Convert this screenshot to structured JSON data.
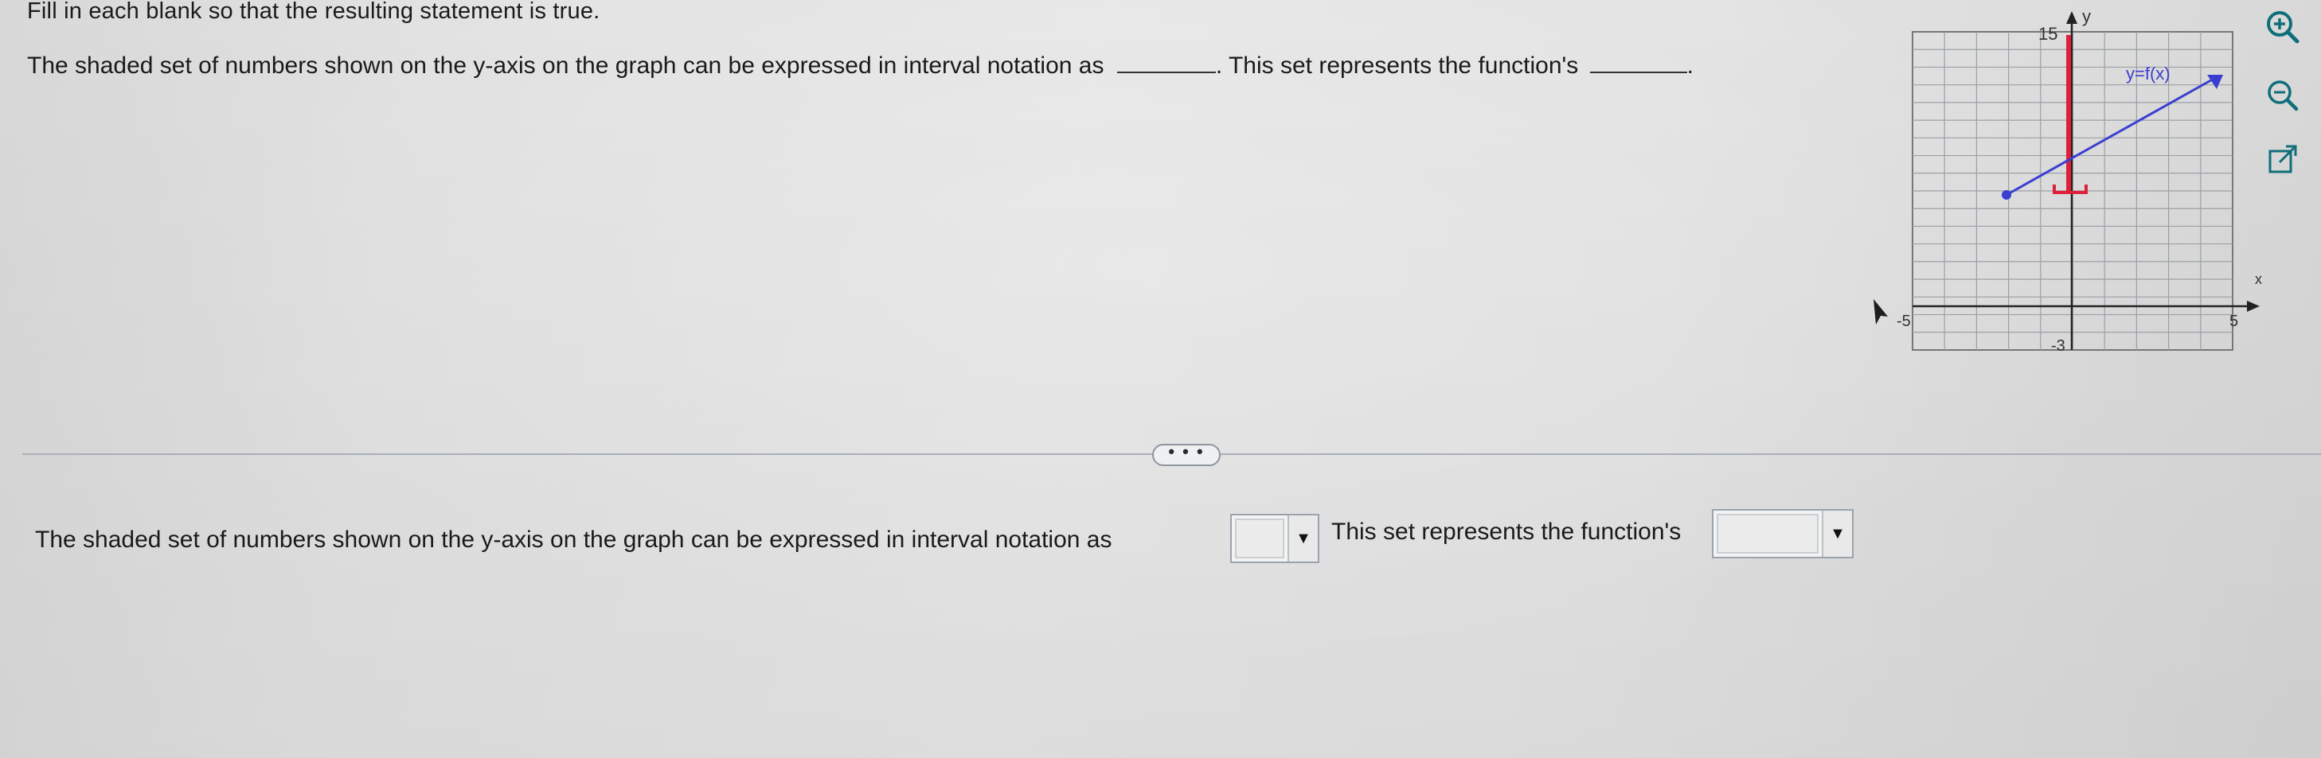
{
  "instruction": "Fill in each blank so that the resulting statement is true.",
  "question": {
    "part1": "The shaded set of numbers shown on the y-axis on the graph can be expressed in interval notation as",
    "part2": ". This set represents the function's",
    "end": "."
  },
  "graph": {
    "y_axis_label": "y",
    "x_axis_label": "x",
    "y_top_label": "15",
    "y_bottom_label": "-3",
    "x_left_label": "-5",
    "x_right_label": "5",
    "function_label": "y=f(x)",
    "line_color": "#3b3fd0",
    "shade_color": "#e0203a"
  },
  "more_button": "• • •",
  "answer": {
    "text1": "The shaded set of numbers shown on the y-axis on the graph can be expressed in interval notation as",
    "text2": "This set represents the function's",
    "select1_value": "",
    "select2_value": ""
  },
  "icons": {
    "zoom_in": "zoom-in-icon",
    "zoom_out": "zoom-out-icon",
    "popout": "external-link-icon",
    "dropdown": "triangle-down-icon"
  }
}
